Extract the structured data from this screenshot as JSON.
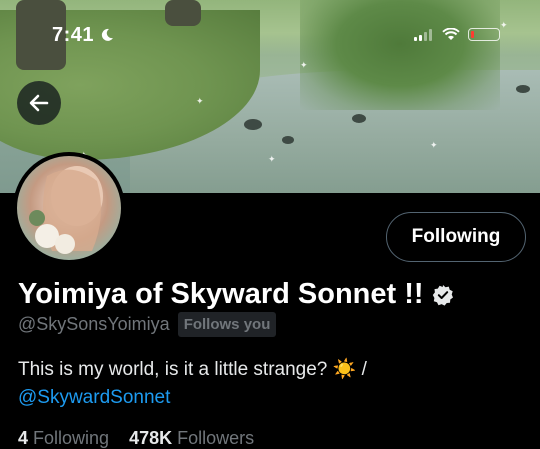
{
  "status_bar": {
    "time": "7:41",
    "moon_icon": "moon-icon",
    "signal_icon": "signal-icon",
    "wifi_icon": "wifi-icon",
    "battery_icon": "battery-icon",
    "battery_level": 0.1,
    "battery_color": "#ff3b30"
  },
  "header": {
    "back_icon": "arrow-left-icon"
  },
  "profile": {
    "display_name": "Yoimiya of Skyward Sonnet !!",
    "verified_icon": "verified-badge-icon",
    "handle": "@SkySonsYoimiya",
    "follows_you": "Follows you",
    "follow_button": "Following",
    "bio_text": "This is my world, is it a little strange? ☀️  /",
    "bio_link": "@SkywardSonnet",
    "stats": {
      "following_count": "4",
      "following_label": "Following",
      "followers_count": "478K",
      "followers_label": "Followers"
    }
  },
  "colors": {
    "background": "#000000",
    "link": "#1d9bf0",
    "muted": "#71767b",
    "button_border": "#536471"
  }
}
